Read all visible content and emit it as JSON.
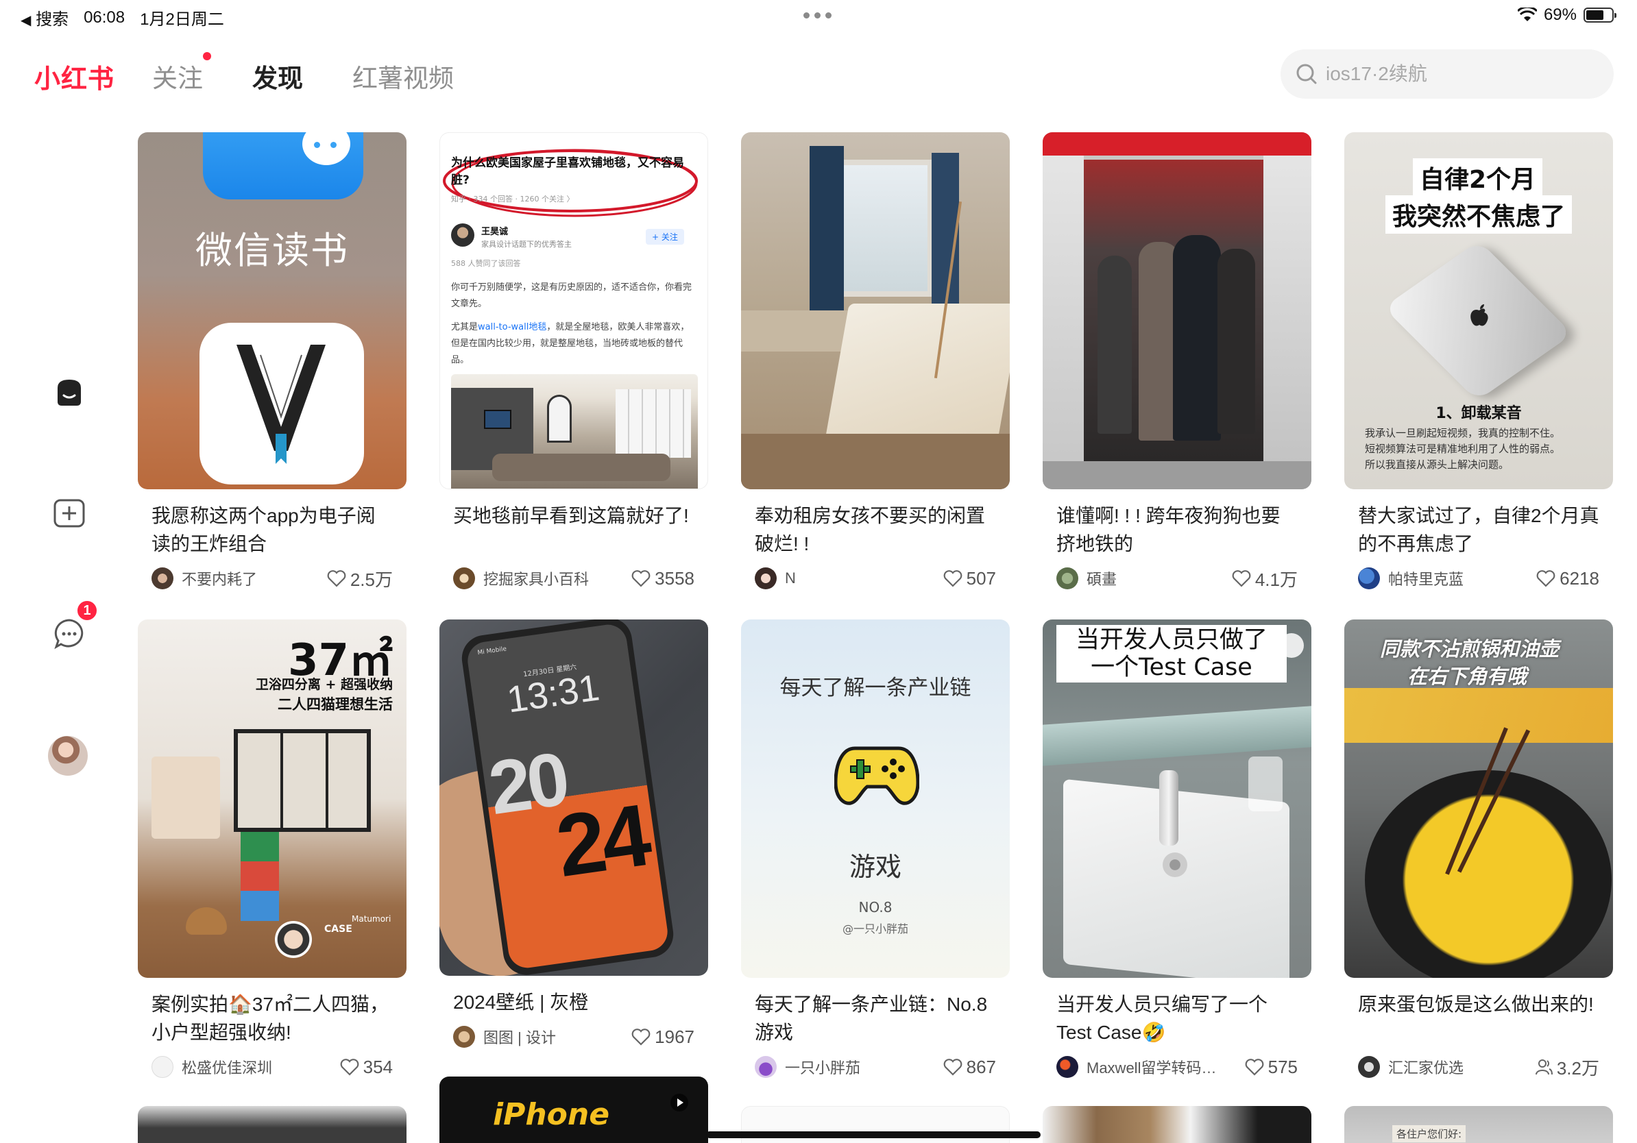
{
  "status_bar": {
    "back_app": "搜索",
    "time": "06:08",
    "date": "1月2日周二",
    "battery": "69%",
    "battery_level": 0.69
  },
  "header": {
    "logo": "小红书",
    "tabs": [
      {
        "label": "关注",
        "has_dot": true
      },
      {
        "label": "发现",
        "active": true
      },
      {
        "label": "红薯视频"
      }
    ],
    "search_placeholder": "ios17·2续航"
  },
  "sidebar": {
    "messages_badge": "1"
  },
  "colors": {
    "brand": "#ff2442",
    "text": "#222222",
    "muted": "#8f8f8f"
  },
  "feed": [
    {
      "title": "我愿称这两个app为电子阅读的王炸组合",
      "author": "不要内耗了",
      "likes": "2.5万",
      "image_text": "微信读书"
    },
    {
      "title": "买地毯前早看到这篇就好了!",
      "author": "挖掘家具小百科",
      "likes": "3558",
      "image_text": {
        "question": "为什么欧美国家屋子里喜欢铺地毯，又不容易脏?",
        "stats": "知乎 · 334 个回答 · 1260 个关注 〉",
        "answerer": "王昊诚",
        "answerer_desc": "家具设计话题下的优秀答主",
        "follow": "+ 关注",
        "agree": "588 人赞同了该回答",
        "p1": "你可千万别随便学，这是有历史原因的，适不适合你，你看完文章先。",
        "p2_before": "尤其是",
        "p2_link": "wall-to-wall地毯",
        "p2_after": "，就是全屋地毯，欧美人非常喜欢，但是在国内比较少用，就是整屋地毯，当地砖或地板的替代品。"
      }
    },
    {
      "title": "奉劝租房女孩不要买的闲置破烂! !",
      "author": "N",
      "likes": "507"
    },
    {
      "title": "谁懂啊! ! ! 跨年夜狗狗也要挤地铁的",
      "author": "碩畫",
      "likes": "4.1万"
    },
    {
      "title": "替大家试过了，自律2个月真的不再焦虑了",
      "author": "帕特里克蓝",
      "likes": "6218",
      "image_text": {
        "line1": "自律2个月",
        "line2": "我突然不焦虑了",
        "point": "1、卸载某音",
        "body1": "我承认一旦刷起短视频，我真的控制不住。",
        "body2": "短视频算法可是精准地利用了人性的弱点。",
        "body3": "所以我直接从源头上解决问题。"
      }
    },
    {
      "title": "案例实拍🏠37㎡二人四猫，小户型超强收纳!",
      "author": "松盛优佳深圳",
      "likes": "354",
      "image_text": {
        "size": "37㎡",
        "line1": "卫浴四分离 + 超强收纳",
        "line2": "二人四猫理想生活",
        "case": "CASE",
        "brand": "Matumori"
      }
    },
    {
      "title": "2024壁纸 | 灰橙",
      "author": "图图 | 设计",
      "likes": "1967",
      "image_text": {
        "carrier": "Mi Mobile",
        "date": "12月30日 星期六",
        "time": "13:31",
        "top_year": "20",
        "bottom_year": "24"
      }
    },
    {
      "title": "每天了解一条产业链：No.8游戏",
      "author": "一只小胖茄",
      "likes": "867",
      "image_text": {
        "heading": "每天了解一条产业链",
        "subject": "游戏",
        "number": "NO.8",
        "handle": "@一只小胖茄"
      }
    },
    {
      "title": "当开发人员只编写了一个Test Case🤣",
      "author": "Maxwell留学转码…",
      "likes": "575",
      "image_text": {
        "line1": "当开发人员只做了",
        "line2": "一个Test Case"
      }
    },
    {
      "title": "原来蛋包饭是这么做出来的!",
      "author": "汇汇家优选",
      "likes": "3.2万",
      "likes_icon": "person",
      "image_text": {
        "line1": "同款不沾煎锅和油壶",
        "line2": "在右下角有哦"
      }
    },
    {
      "title": "",
      "author": "",
      "likes": "",
      "image_text": {
        "banner": "iPhone"
      }
    },
    {
      "title": "",
      "author": "",
      "likes": "",
      "image_text": {
        "note": "各住户您们好:"
      }
    }
  ]
}
